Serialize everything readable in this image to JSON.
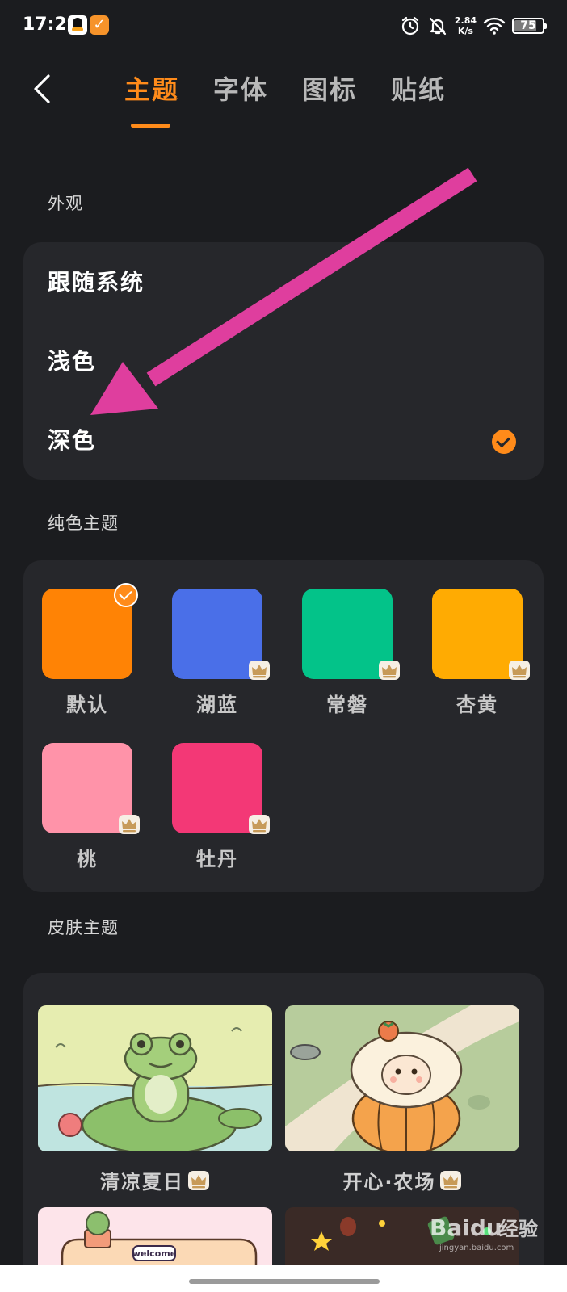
{
  "status_bar": {
    "time": "17:29",
    "speed_value": "2.84",
    "speed_unit": "K/s",
    "battery": "75"
  },
  "nav": {
    "back_icon": "chevron-left-icon",
    "tabs": [
      {
        "label": "主题",
        "active": true
      },
      {
        "label": "字体",
        "active": false
      },
      {
        "label": "图标",
        "active": false
      },
      {
        "label": "贴纸",
        "active": false
      }
    ]
  },
  "appearance": {
    "title": "外观",
    "options": [
      {
        "label": "跟随系统",
        "selected": false
      },
      {
        "label": "浅色",
        "selected": false
      },
      {
        "label": "深色",
        "selected": true
      }
    ]
  },
  "solid_themes": {
    "title": "纯色主题",
    "items": [
      {
        "label": "默认",
        "color": "#ff8305",
        "selected": true,
        "premium": false
      },
      {
        "label": "湖蓝",
        "color": "#4a6fe8",
        "selected": false,
        "premium": true
      },
      {
        "label": "常磐",
        "color": "#03c389",
        "selected": false,
        "premium": true
      },
      {
        "label": "杏黄",
        "color": "#ffab02",
        "selected": false,
        "premium": true
      },
      {
        "label": "桃",
        "color": "#ff93a9",
        "selected": false,
        "premium": true
      },
      {
        "label": "牡丹",
        "color": "#f33876",
        "selected": false,
        "premium": true
      }
    ]
  },
  "skin_themes": {
    "title": "皮肤主题",
    "items": [
      {
        "label": "清凉夏日",
        "premium": true
      },
      {
        "label": "开心·农场",
        "premium": true
      },
      {
        "label": "",
        "badge_text": "welcome"
      },
      {
        "label": ""
      }
    ]
  },
  "watermark": {
    "brand": "Baidu",
    "brand_cn": "经验",
    "site": "jingyan.baidu.com"
  },
  "colors": {
    "accent": "#ff8b1a",
    "background": "#1b1c1f",
    "card": "#26272b",
    "annotation_arrow": "#df3e9e"
  }
}
